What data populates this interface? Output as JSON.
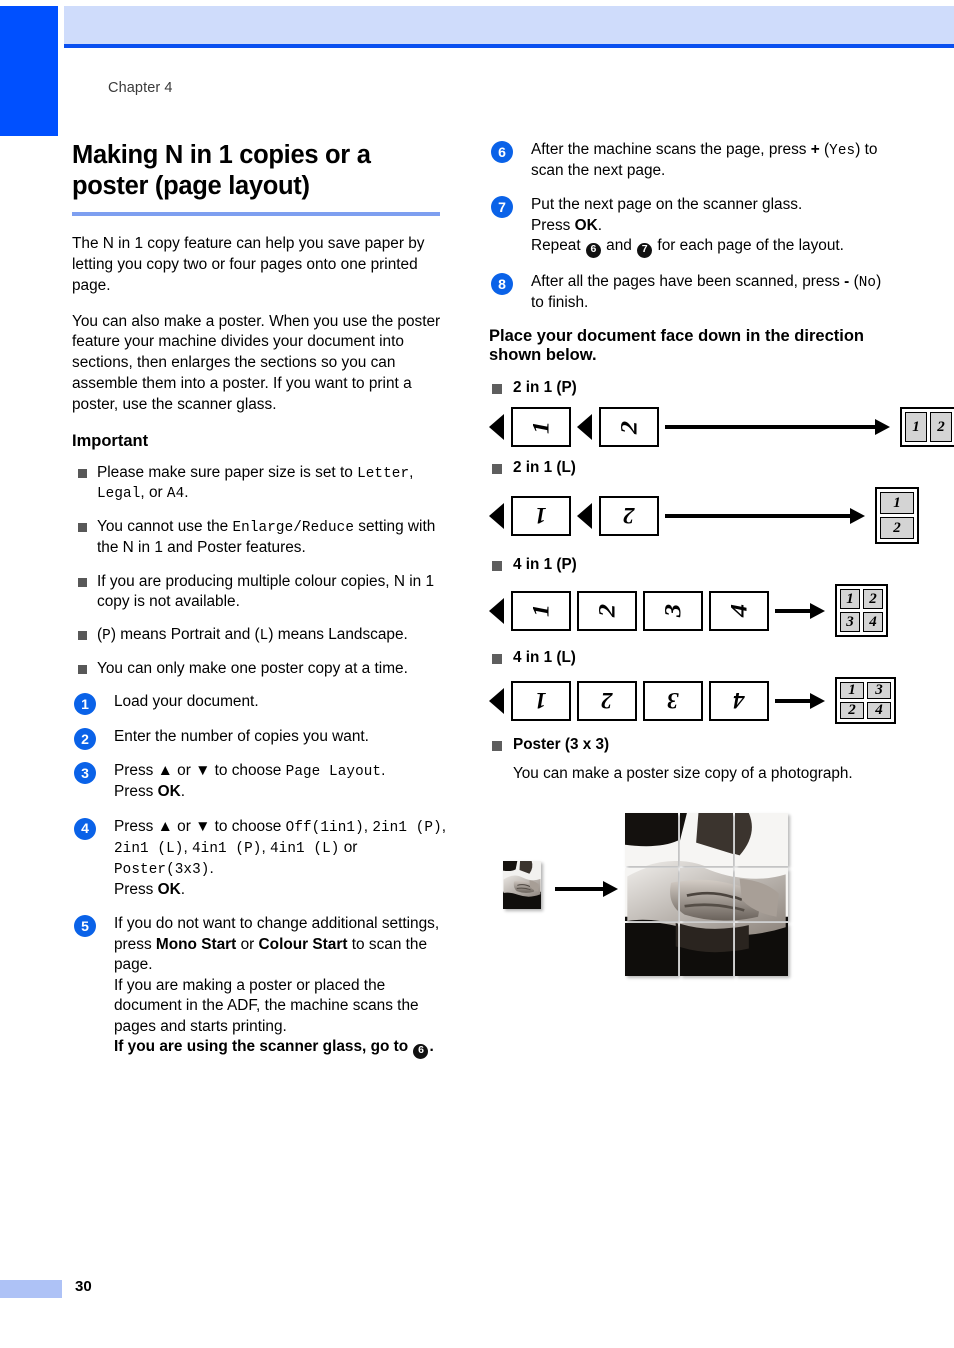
{
  "page": {
    "chapter_label": "Chapter 4",
    "page_number": "30"
  },
  "left_column": {
    "title": "Making N in 1 copies or a poster (page layout)",
    "intro_paragraphs": [
      "The N in 1 copy feature can help you save paper by letting you copy two or four pages onto one printed page.",
      "You can also make a poster. When you use the poster feature your machine divides your document into sections, then enlarges the sections so you can assemble them into a poster. If you want to print a poster, use the scanner glass."
    ],
    "important_heading": "Important",
    "important_bullets": [
      {
        "parts": [
          {
            "t": "Please make sure paper size is set to ",
            "s": "n"
          },
          {
            "t": "Letter",
            "s": "m"
          },
          {
            "t": ", ",
            "s": "n"
          },
          {
            "t": "Legal",
            "s": "m"
          },
          {
            "t": ", or ",
            "s": "n"
          },
          {
            "t": "A4",
            "s": "m"
          },
          {
            "t": ".",
            "s": "n"
          }
        ]
      },
      {
        "parts": [
          {
            "t": "You cannot use the ",
            "s": "n"
          },
          {
            "t": "Enlarge/Reduce",
            "s": "m"
          },
          {
            "t": " setting with the N in 1 and Poster features.",
            "s": "n"
          }
        ]
      },
      {
        "parts": [
          {
            "t": "If you are producing multiple colour copies, N in 1 copy is not available.",
            "s": "n"
          }
        ]
      },
      {
        "parts": [
          {
            "t": "(",
            "s": "n"
          },
          {
            "t": "P",
            "s": "m"
          },
          {
            "t": ") means Portrait and (",
            "s": "n"
          },
          {
            "t": "L",
            "s": "m"
          },
          {
            "t": ") means Landscape.",
            "s": "n"
          }
        ]
      },
      {
        "parts": [
          {
            "t": "You can only make one poster copy at a time.",
            "s": "n"
          }
        ]
      }
    ],
    "steps": [
      {
        "num": "1",
        "parts": [
          {
            "t": "Load your document.",
            "s": "n"
          }
        ]
      },
      {
        "num": "2",
        "parts": [
          {
            "t": "Enter the number of copies you want.",
            "s": "n"
          }
        ]
      },
      {
        "num": "3",
        "parts": [
          {
            "t": "Press ",
            "s": "n"
          },
          {
            "t": "▲",
            "s": "n"
          },
          {
            "t": " or ",
            "s": "n"
          },
          {
            "t": "▼",
            "s": "n"
          },
          {
            "t": " to choose ",
            "s": "n"
          },
          {
            "t": "Page Layout",
            "s": "m"
          },
          {
            "t": ".",
            "s": "n"
          },
          {
            "t": "\n",
            "s": "br"
          },
          {
            "t": "Press ",
            "s": "n"
          },
          {
            "t": "OK",
            "s": "b"
          },
          {
            "t": ".",
            "s": "n"
          }
        ]
      },
      {
        "num": "4",
        "parts": [
          {
            "t": "Press ",
            "s": "n"
          },
          {
            "t": "▲",
            "s": "n"
          },
          {
            "t": " or ",
            "s": "n"
          },
          {
            "t": "▼",
            "s": "n"
          },
          {
            "t": " to choose ",
            "s": "n"
          },
          {
            "t": "Off(1in1)",
            "s": "m"
          },
          {
            "t": ", ",
            "s": "n"
          },
          {
            "t": "2in1 (P)",
            "s": "m"
          },
          {
            "t": ", ",
            "s": "n"
          },
          {
            "t": "2in1 (L)",
            "s": "m"
          },
          {
            "t": ", ",
            "s": "n"
          },
          {
            "t": "4in1 (P)",
            "s": "m"
          },
          {
            "t": ", ",
            "s": "n"
          },
          {
            "t": "4in1 (L)",
            "s": "m"
          },
          {
            "t": " or ",
            "s": "n"
          },
          {
            "t": "Poster(3x3)",
            "s": "m"
          },
          {
            "t": ".",
            "s": "n"
          },
          {
            "t": "\n",
            "s": "br"
          },
          {
            "t": "Press ",
            "s": "n"
          },
          {
            "t": "OK",
            "s": "b"
          },
          {
            "t": ".",
            "s": "n"
          }
        ]
      },
      {
        "num": "5",
        "parts": [
          {
            "t": "If you do not want to change additional settings, press ",
            "s": "n"
          },
          {
            "t": "Mono Start",
            "s": "b"
          },
          {
            "t": " or ",
            "s": "n"
          },
          {
            "t": "Colour Start",
            "s": "b"
          },
          {
            "t": " to scan the page.",
            "s": "n"
          },
          {
            "t": "\n",
            "s": "br"
          },
          {
            "t": "If you are making a poster or placed the document in the ADF, the machine scans the pages and starts printing.",
            "s": "n"
          },
          {
            "t": "\n",
            "s": "br"
          },
          {
            "t": "If you are using the scanner glass, go to ",
            "s": "b"
          },
          {
            "t": "6",
            "s": "circ"
          },
          {
            "t": ".",
            "s": "b"
          }
        ]
      }
    ]
  },
  "right_column": {
    "steps": [
      {
        "num": "6",
        "parts": [
          {
            "t": "After the machine scans the page, press ",
            "s": "n"
          },
          {
            "t": "+",
            "s": "b"
          },
          {
            "t": " (",
            "s": "n"
          },
          {
            "t": "Yes",
            "s": "m"
          },
          {
            "t": ") to scan the next page.",
            "s": "n"
          }
        ]
      },
      {
        "num": "7",
        "parts": [
          {
            "t": "Put the next page on the scanner glass.",
            "s": "n"
          },
          {
            "t": "\n",
            "s": "br"
          },
          {
            "t": "Press ",
            "s": "n"
          },
          {
            "t": "OK",
            "s": "b"
          },
          {
            "t": ".",
            "s": "n"
          },
          {
            "t": "\n",
            "s": "br"
          },
          {
            "t": "Repeat ",
            "s": "n"
          },
          {
            "t": "6",
            "s": "circ"
          },
          {
            "t": " and ",
            "s": "n"
          },
          {
            "t": "7",
            "s": "circ"
          },
          {
            "t": " for each page of the layout.",
            "s": "n"
          }
        ]
      },
      {
        "num": "8",
        "parts": [
          {
            "t": "After all the pages have been scanned, press ",
            "s": "n"
          },
          {
            "t": "-",
            "s": "b"
          },
          {
            "t": " (",
            "s": "n"
          },
          {
            "t": "No",
            "s": "m"
          },
          {
            "t": ") to finish.",
            "s": "n"
          }
        ]
      }
    ],
    "placement_heading": "Place your document face down in the direction shown below.",
    "layouts": [
      {
        "label": "2 in 1 (P)",
        "orientation": "portrait-source",
        "leading_arrows": [
          "before-1",
          "before-2"
        ],
        "pages": [
          "1",
          "2"
        ],
        "result": {
          "kind": "res2p",
          "cells": [
            "1",
            "2"
          ]
        }
      },
      {
        "label": "2 in 1 (L)",
        "orientation": "landscape-source",
        "leading_arrows": [
          "before-1",
          "before-2"
        ],
        "pages": [
          "1",
          "2"
        ],
        "result": {
          "kind": "res2l",
          "cells": [
            "1",
            "2"
          ]
        }
      },
      {
        "label": "4 in 1 (P)",
        "orientation": "portrait-source",
        "leading_arrows": [
          "before-1"
        ],
        "pages": [
          "1",
          "2",
          "3",
          "4"
        ],
        "result": {
          "kind": "res4p",
          "cells": [
            "1",
            "2",
            "3",
            "4"
          ]
        }
      },
      {
        "label": "4 in 1 (L)",
        "orientation": "landscape-source",
        "leading_arrows": [
          "before-1"
        ],
        "pages": [
          "1",
          "2",
          "3",
          "4"
        ],
        "result": {
          "kind": "res4l",
          "cells": [
            "1",
            "3",
            "2",
            "4"
          ]
        }
      }
    ],
    "poster": {
      "label": "Poster (3 x 3)",
      "description": "You can make a poster size copy of a photograph.",
      "illustration": "handshake-photo-split-into-3x3-grid"
    }
  },
  "colors": {
    "header_band": "#cfdcfb",
    "header_rule": "#0a50f0",
    "header_tab": "#0050ff",
    "title_rule": "#7e9ff0",
    "step_circle": "#0a62e8",
    "bullet_square": "#585858",
    "footer_bar": "#aec2f6"
  }
}
